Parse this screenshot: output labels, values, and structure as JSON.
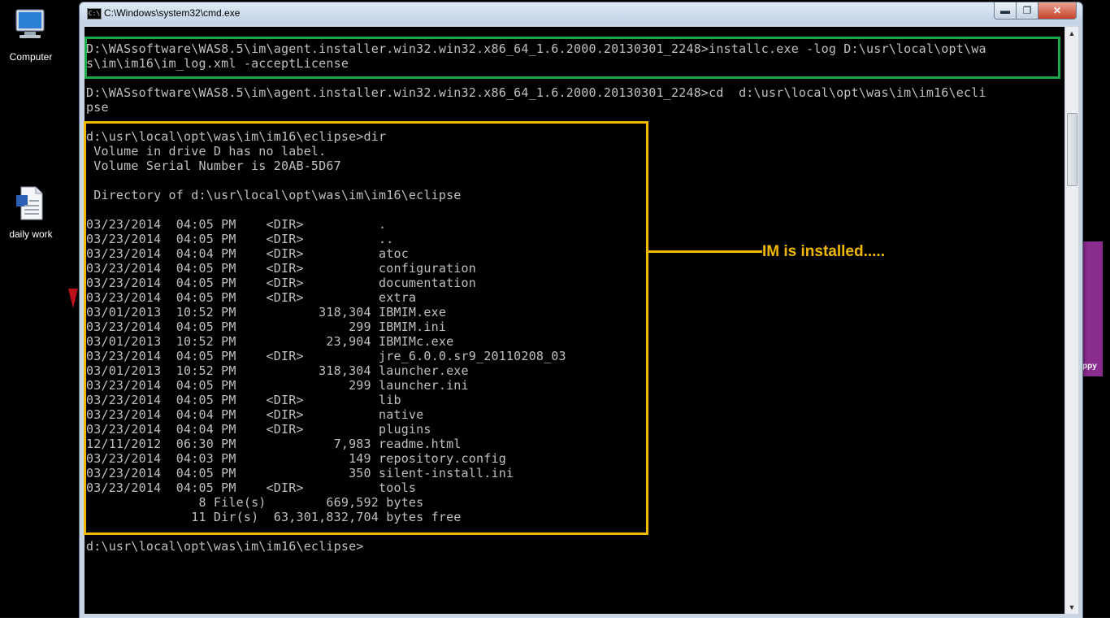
{
  "desktop": {
    "icons": [
      {
        "label": "Computer",
        "icon": "computer-icon"
      },
      {
        "label": "daily work",
        "icon": "document-icon"
      }
    ],
    "partial_right_text": "ppy"
  },
  "window": {
    "title": "C:\\Windows\\system32\\cmd.exe",
    "controls": {
      "minimize": "▬",
      "maximize": "❐",
      "close": "✕"
    }
  },
  "console": {
    "lines": [
      "D:\\WASsoftware\\WAS8.5\\im\\agent.installer.win32.win32.x86_64_1.6.2000.20130301_2248>installc.exe -log D:\\usr\\local\\opt\\wa",
      "s\\im\\im16\\im_log.xml -acceptLicense",
      "",
      "D:\\WASsoftware\\WAS8.5\\im\\agent.installer.win32.win32.x86_64_1.6.2000.20130301_2248>cd  d:\\usr\\local\\opt\\was\\im\\im16\\ecli",
      "pse",
      "",
      "d:\\usr\\local\\opt\\was\\im\\im16\\eclipse>dir",
      " Volume in drive D has no label.",
      " Volume Serial Number is 20AB-5D67",
      "",
      " Directory of d:\\usr\\local\\opt\\was\\im\\im16\\eclipse",
      "",
      "03/23/2014  04:05 PM    <DIR>          .",
      "03/23/2014  04:05 PM    <DIR>          ..",
      "03/23/2014  04:04 PM    <DIR>          atoc",
      "03/23/2014  04:05 PM    <DIR>          configuration",
      "03/23/2014  04:05 PM    <DIR>          documentation",
      "03/23/2014  04:05 PM    <DIR>          extra",
      "03/01/2013  10:52 PM           318,304 IBMIM.exe",
      "03/23/2014  04:05 PM               299 IBMIM.ini",
      "03/01/2013  10:52 PM            23,904 IBMIMc.exe",
      "03/23/2014  04:05 PM    <DIR>          jre_6.0.0.sr9_20110208_03",
      "03/01/2013  10:52 PM           318,304 launcher.exe",
      "03/23/2014  04:05 PM               299 launcher.ini",
      "03/23/2014  04:05 PM    <DIR>          lib",
      "03/23/2014  04:04 PM    <DIR>          native",
      "03/23/2014  04:04 PM    <DIR>          plugins",
      "12/11/2012  06:30 PM             7,983 readme.html",
      "03/23/2014  04:03 PM               149 repository.config",
      "03/23/2014  04:05 PM               350 silent-install.ini",
      "03/23/2014  04:05 PM    <DIR>          tools",
      "               8 File(s)        669,592 bytes",
      "              11 Dir(s)  63,301,832,704 bytes free",
      "",
      "d:\\usr\\local\\opt\\was\\im\\im16\\eclipse>"
    ]
  },
  "annotation": {
    "text": "IM is installed.....",
    "color": "#f2b705"
  },
  "colors": {
    "highlight_green": "#1aa84a",
    "highlight_yellow": "#f2b705",
    "console_text": "#c0c0c0"
  }
}
